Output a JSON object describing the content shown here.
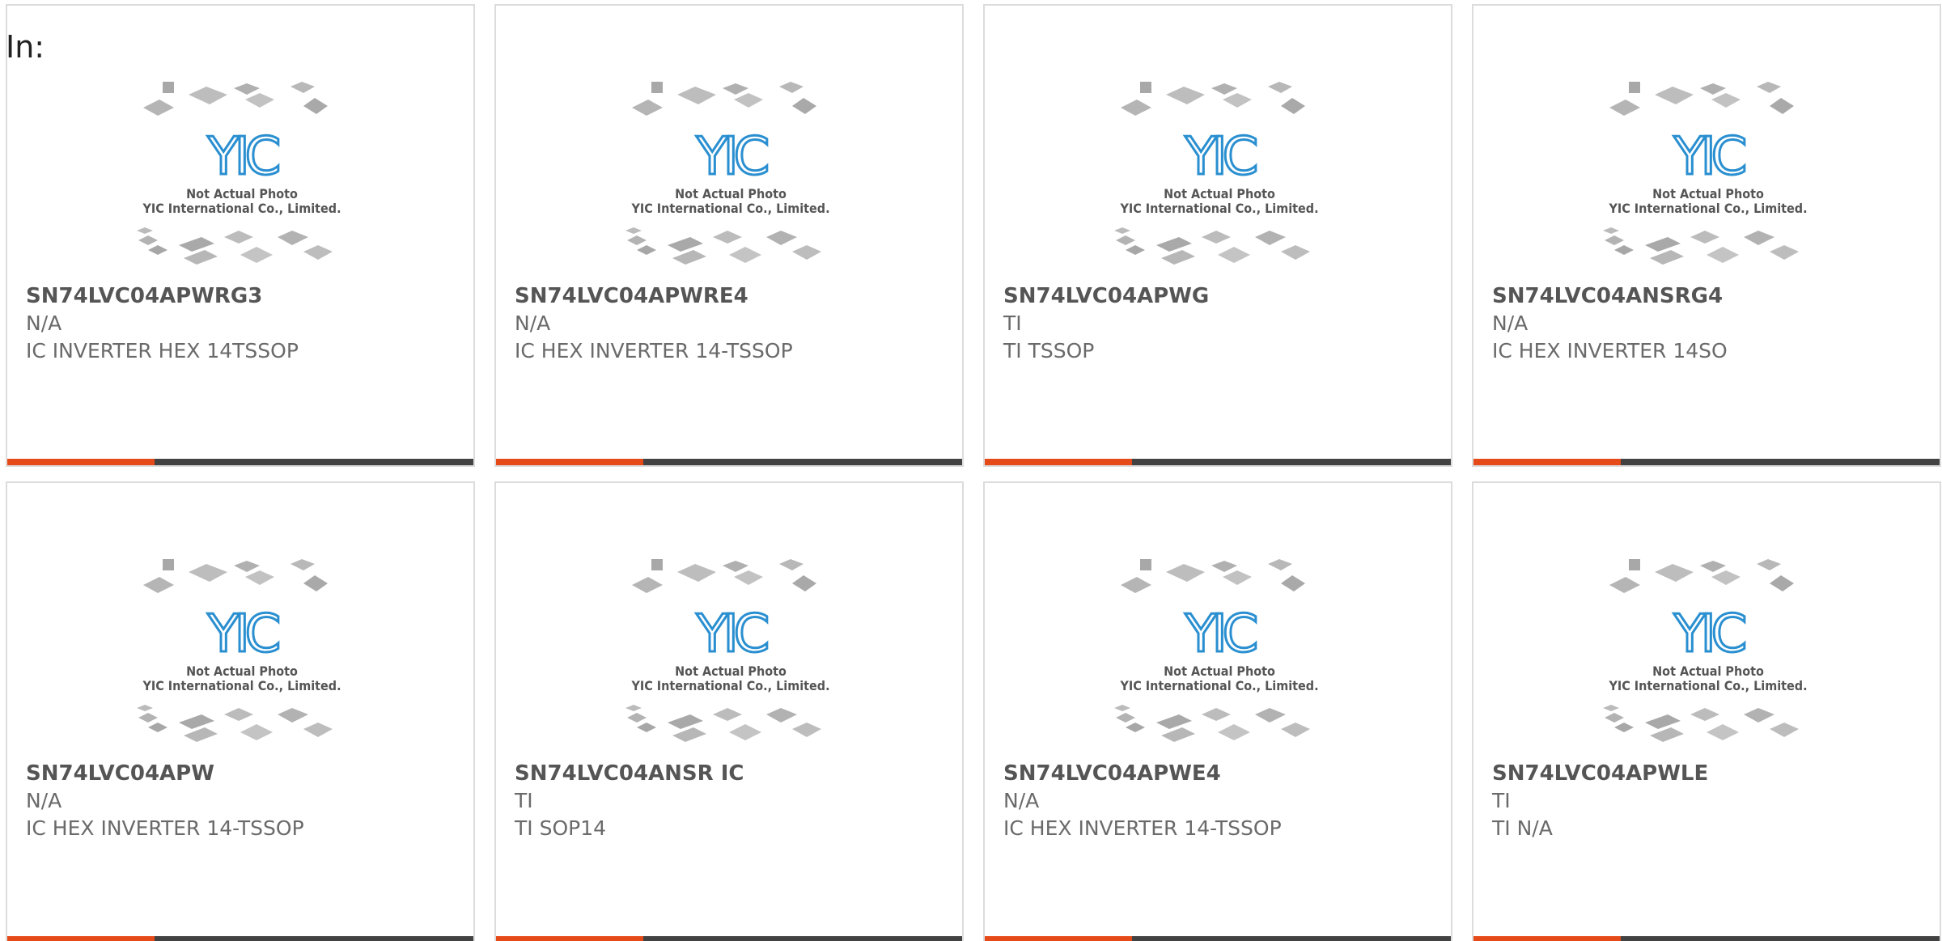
{
  "page": {
    "label": "In:"
  },
  "placeholder_image": {
    "line1": "Not Actual Photo",
    "line2": "YIC International Co., Limited.",
    "logo_text": "YIC"
  },
  "colors": {
    "accent": "#e64a19",
    "bar": "#424242",
    "logo": "#2a8fd0"
  },
  "products": [
    {
      "part": "SN74LVC04APWRG3",
      "mfr": "N/A",
      "desc": "IC INVERTER HEX 14TSSOP"
    },
    {
      "part": "SN74LVC04APWRE4",
      "mfr": "N/A",
      "desc": "IC HEX INVERTER 14-TSSOP"
    },
    {
      "part": "SN74LVC04APWG",
      "mfr": "TI",
      "desc": "TI TSSOP"
    },
    {
      "part": "SN74LVC04ANSRG4",
      "mfr": "N/A",
      "desc": "IC HEX INVERTER 14SO"
    },
    {
      "part": "SN74LVC04APW",
      "mfr": "N/A",
      "desc": "IC HEX INVERTER 14-TSSOP"
    },
    {
      "part": "SN74LVC04ANSR IC",
      "mfr": "TI",
      "desc": "TI SOP14"
    },
    {
      "part": "SN74LVC04APWE4",
      "mfr": "N/A",
      "desc": "IC HEX INVERTER 14-TSSOP"
    },
    {
      "part": "SN74LVC04APWLE",
      "mfr": "TI",
      "desc": "TI N/A"
    }
  ]
}
